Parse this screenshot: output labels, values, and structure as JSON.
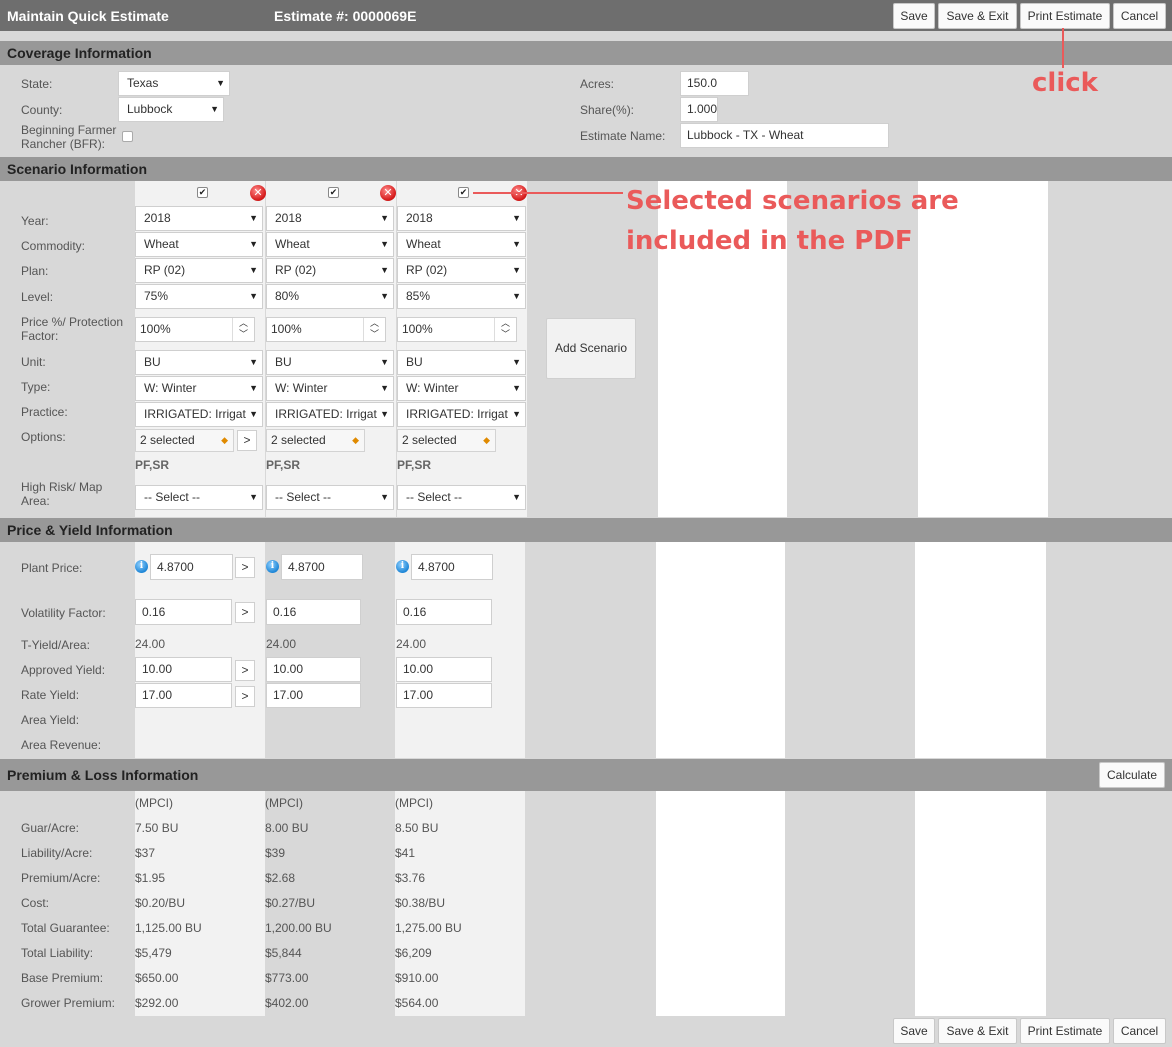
{
  "header": {
    "title": "Maintain Quick Estimate",
    "estimate_label": "Estimate #: 0000069E",
    "buttons": {
      "save": "Save",
      "save_exit": "Save & Exit",
      "print": "Print Estimate",
      "cancel": "Cancel"
    }
  },
  "coverage": {
    "section_title": "Coverage Information",
    "state_label": "State:",
    "state_value": "Texas",
    "county_label": "County:",
    "county_value": "Lubbock",
    "bfr_label": "Beginning Farmer Rancher (BFR):",
    "acres_label": "Acres:",
    "acres_value": "150.0",
    "share_label": "Share(%):",
    "share_value": "1.000",
    "estimate_name_label": "Estimate Name:",
    "estimate_name_value": "Lubbock - TX - Wheat"
  },
  "scenario": {
    "section_title": "Scenario Information",
    "labels": {
      "year": "Year:",
      "commodity": "Commodity:",
      "plan": "Plan:",
      "level": "Level:",
      "price_pct": "Price %/ Protection Factor:",
      "unit": "Unit:",
      "type": "Type:",
      "practice": "Practice:",
      "options": "Options:",
      "high_risk": "High Risk/ Map Area:"
    },
    "add_scenario": "Add Scenario",
    "columns": [
      {
        "checked": "✔",
        "year": "2018",
        "commodity": "Wheat",
        "plan": "RP (02)",
        "level": "75%",
        "price_pct": "100%",
        "unit": "BU",
        "type": "W: Winter",
        "practice": "IRRIGATED: Irrigat",
        "options": "2 selected",
        "options_codes": "PF,SR",
        "high_risk": "-- Select --"
      },
      {
        "checked": "✔",
        "year": "2018",
        "commodity": "Wheat",
        "plan": "RP (02)",
        "level": "80%",
        "price_pct": "100%",
        "unit": "BU",
        "type": "W: Winter",
        "practice": "IRRIGATED: Irrigat",
        "options": "2 selected",
        "options_codes": "PF,SR",
        "high_risk": "-- Select --"
      },
      {
        "checked": "✔",
        "year": "2018",
        "commodity": "Wheat",
        "plan": "RP (02)",
        "level": "85%",
        "price_pct": "100%",
        "unit": "BU",
        "type": "W: Winter",
        "practice": "IRRIGATED: Irrigat",
        "options": "2 selected",
        "options_codes": "PF,SR",
        "high_risk": "-- Select --"
      }
    ]
  },
  "price_yield": {
    "section_title": "Price & Yield Information",
    "labels": {
      "plant_price": "Plant Price:",
      "volatility": "Volatility Factor:",
      "t_yield": "T-Yield/Area:",
      "approved_yield": "Approved Yield:",
      "rate_yield": "Rate Yield:",
      "area_yield": "Area Yield:",
      "area_revenue": "Area Revenue:"
    },
    "columns": [
      {
        "plant_price": "4.8700",
        "volatility": "0.16",
        "t_yield": "24.00",
        "approved_yield": "10.00",
        "rate_yield": "17.00"
      },
      {
        "plant_price": "4.8700",
        "volatility": "0.16",
        "t_yield": "24.00",
        "approved_yield": "10.00",
        "rate_yield": "17.00"
      },
      {
        "plant_price": "4.8700",
        "volatility": "0.16",
        "t_yield": "24.00",
        "approved_yield": "10.00",
        "rate_yield": "17.00"
      }
    ]
  },
  "premium": {
    "section_title": "Premium & Loss Information",
    "calculate": "Calculate",
    "labels": {
      "guar_acre": "Guar/Acre:",
      "liability_acre": "Liability/Acre:",
      "premium_acre": "Premium/Acre:",
      "cost": "Cost:",
      "total_guarantee": "Total Guarantee:",
      "total_liability": "Total Liability:",
      "base_premium": "Base Premium:",
      "grower_premium": "Grower Premium:"
    },
    "columns": [
      {
        "type": "(MPCI)",
        "guar_acre": "7.50 BU",
        "liability_acre": "$37",
        "premium_acre": "$1.95",
        "cost": "$0.20/BU",
        "total_guarantee": "1,125.00 BU",
        "total_liability": "$5,479",
        "base_premium": "$650.00",
        "grower_premium": "$292.00"
      },
      {
        "type": "(MPCI)",
        "guar_acre": "8.00 BU",
        "liability_acre": "$39",
        "premium_acre": "$2.68",
        "cost": "$0.27/BU",
        "total_guarantee": "1,200.00 BU",
        "total_liability": "$5,844",
        "base_premium": "$773.00",
        "grower_premium": "$402.00"
      },
      {
        "type": "(MPCI)",
        "guar_acre": "8.50 BU",
        "liability_acre": "$41",
        "premium_acre": "$3.76",
        "cost": "$0.38/BU",
        "total_guarantee": "1,275.00 BU",
        "total_liability": "$6,209",
        "base_premium": "$910.00",
        "grower_premium": "$564.00"
      }
    ]
  },
  "annotations": {
    "click": "click",
    "selected_line1": "Selected scenarios are",
    "selected_line2": "included in the PDF",
    "color": "#ea5a5a"
  },
  "icons": {
    "delete": "delete-x-icon",
    "info": "info-icon",
    "checkbox": "checkbox-icon"
  }
}
